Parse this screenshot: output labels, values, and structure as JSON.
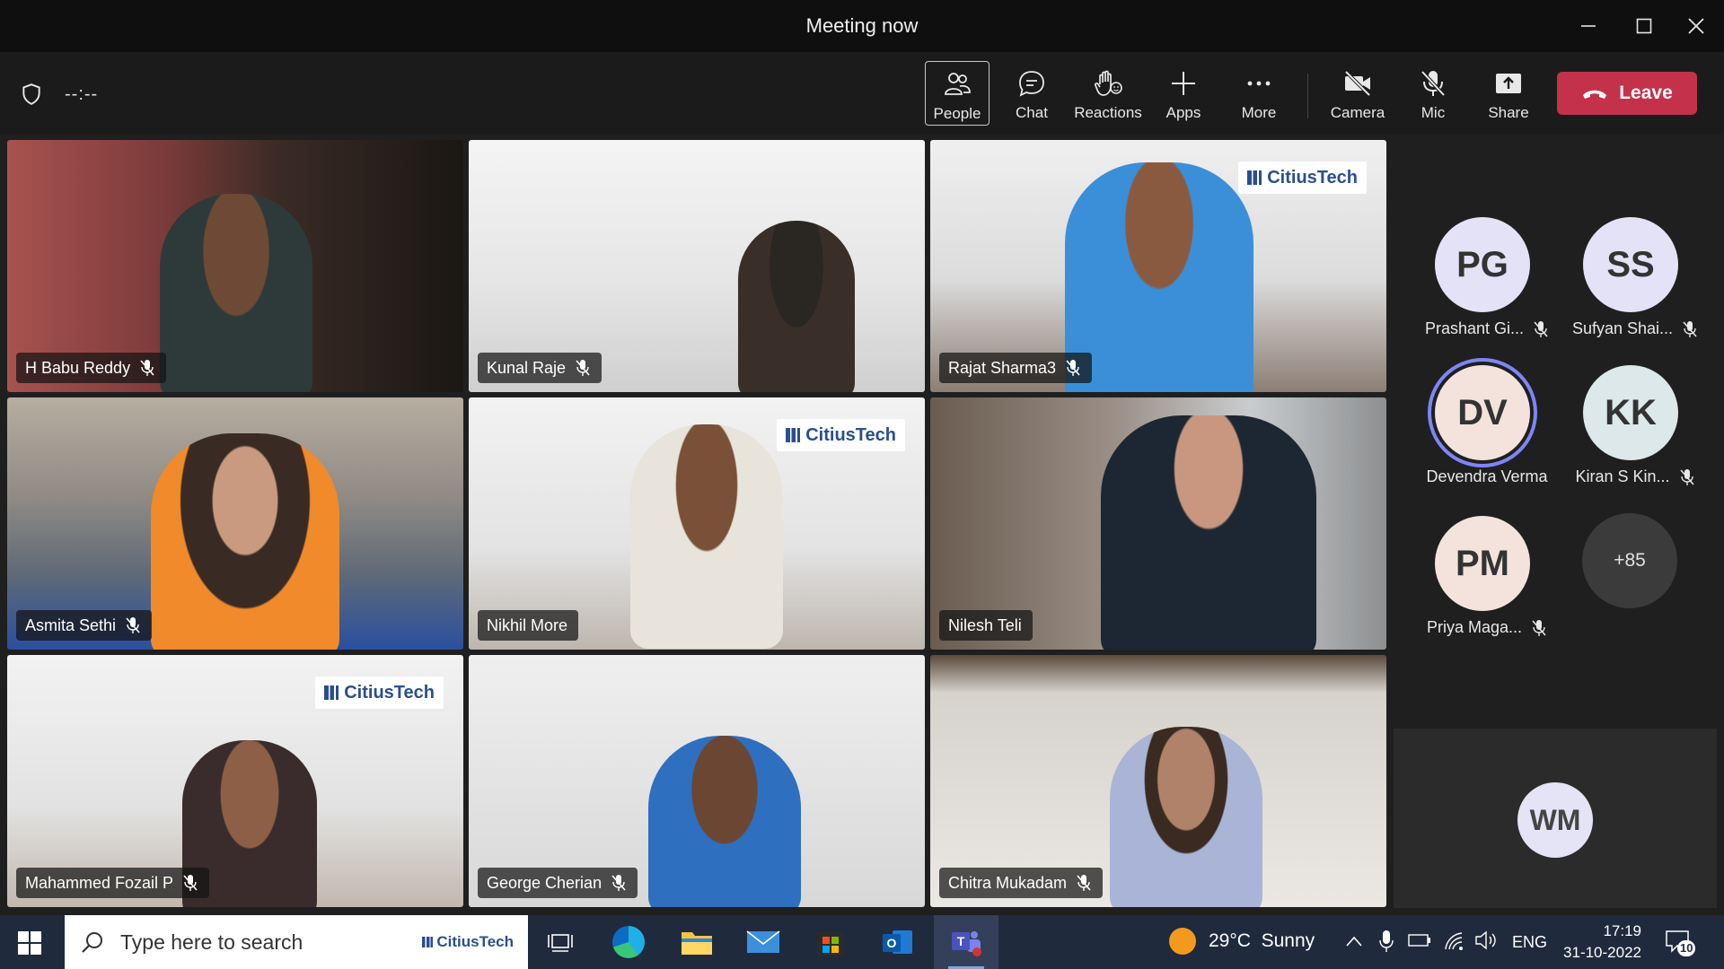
{
  "window": {
    "title": "Meeting now"
  },
  "toolbar": {
    "timer": "--:--",
    "buttons": {
      "people": "People",
      "chat": "Chat",
      "reactions": "Reactions",
      "apps": "Apps",
      "more": "More",
      "camera": "Camera",
      "mic": "Mic",
      "share": "Share"
    },
    "leave": "Leave"
  },
  "videos": [
    {
      "name": "H Babu Reddy",
      "muted": true
    },
    {
      "name": "Kunal Raje",
      "muted": true
    },
    {
      "name": "Rajat Sharma3",
      "muted": true,
      "logo": "CitiusTech"
    },
    {
      "name": "Asmita Sethi",
      "muted": true
    },
    {
      "name": "Nikhil More",
      "muted": false,
      "speaking": true,
      "logo": "CitiusTech"
    },
    {
      "name": "Nilesh Teli",
      "muted": false
    },
    {
      "name": "Mahammed Fozail P",
      "muted": true,
      "logo": "CitiusTech"
    },
    {
      "name": "George Cherian",
      "muted": true
    },
    {
      "name": "Chitra Mukadam",
      "muted": true
    }
  ],
  "participants": [
    {
      "initials": "PG",
      "name": "Prashant Gi...",
      "muted": true,
      "color": "#e4e2f7"
    },
    {
      "initials": "SS",
      "name": "Sufyan Shai...",
      "muted": true,
      "color": "#e4e2f7"
    },
    {
      "initials": "DV",
      "name": "Devendra Verma",
      "muted": false,
      "speaking": true,
      "color": "#f3e3dc"
    },
    {
      "initials": "KK",
      "name": "Kiran S Kin...",
      "muted": true,
      "color": "#dce8ea"
    },
    {
      "initials": "PM",
      "name": "Priya Maga...",
      "muted": true,
      "color": "#f3e3dc"
    }
  ],
  "overflow_count": "+85",
  "bottom_tile": {
    "initials": "WM"
  },
  "taskbar": {
    "search_placeholder": "Type here to search",
    "search_logo": "CitiusTech",
    "weather": "29°C  Sunny",
    "language": "ENG",
    "time": "17:19",
    "date": "31-10-2022",
    "notifications": "10"
  }
}
